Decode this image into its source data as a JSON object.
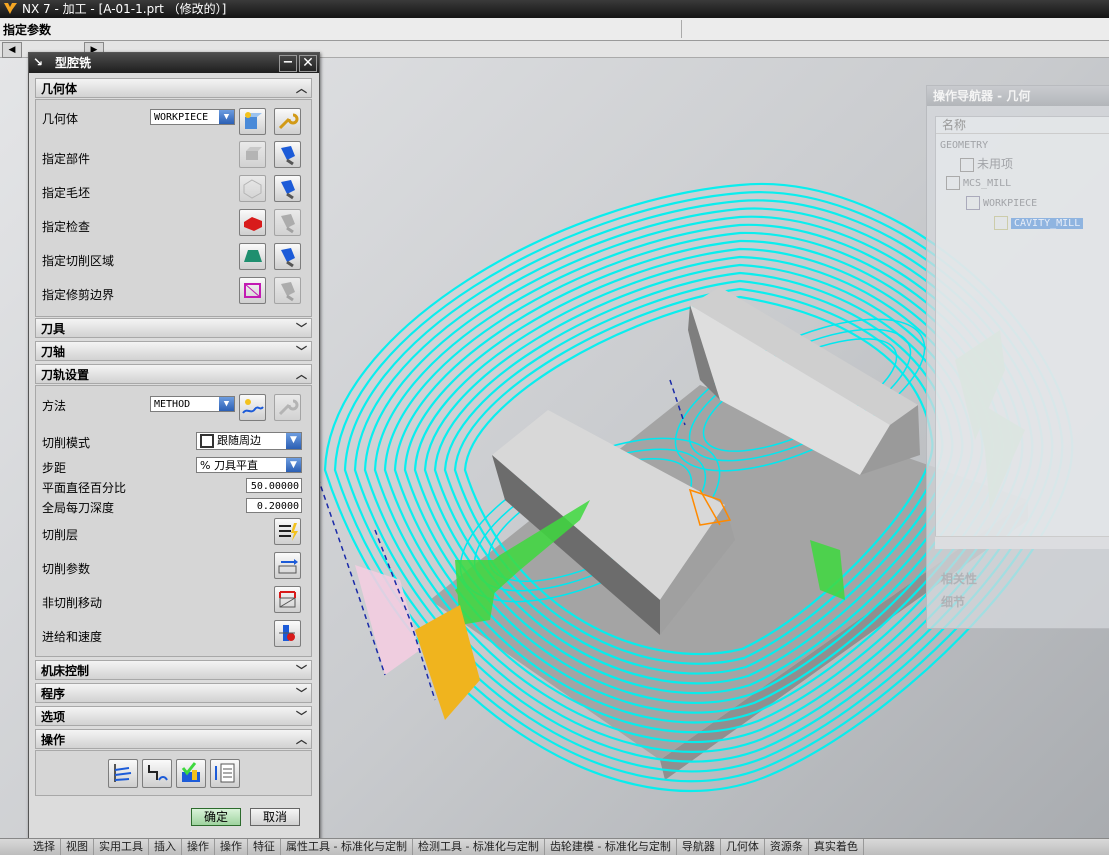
{
  "window": {
    "title": "NX 7 - 加工 - [A-01-1.prt （修改的）]"
  },
  "cue": {
    "label": "指定参数"
  },
  "dialog": {
    "title": "型腔铣",
    "sections": {
      "geometry": "几何体",
      "tool": "刀具",
      "axis": "刀轴",
      "path": "刀轨设置",
      "machine": "机床控制",
      "program": "程序",
      "options": "选项",
      "actions": "操作"
    },
    "geometry": {
      "geometry_label": "几何体",
      "geometry_value": "WORKPIECE",
      "part_label": "指定部件",
      "blank_label": "指定毛坯",
      "check_label": "指定检查",
      "cut_area_label": "指定切削区域",
      "trim_label": "指定修剪边界"
    },
    "path": {
      "method_label": "方法",
      "method_value": "METHOD",
      "cut_pattern_label": "切削模式",
      "cut_pattern_value": "跟随周边",
      "stepover_label": "步距",
      "stepover_value": "% 刀具平直",
      "percent_label": "平面直径百分比",
      "percent_value": "50.00000",
      "depth_label": "全局每刀深度",
      "depth_value": "0.20000",
      "levels_label": "切削层",
      "params_label": "切削参数",
      "noncut_label": "非切削移动",
      "feeds_label": "进给和速度"
    },
    "ok_label": "确定",
    "cancel_label": "取消"
  },
  "navigator": {
    "title": "操作导航器 - 几何",
    "column": "名称",
    "rows": [
      "GEOMETRY",
      "未用项",
      "MCS_MILL",
      "WORKPIECE",
      "CAVITY_MILL"
    ],
    "footer1": "相关性",
    "footer2": "细节"
  },
  "taskbar": {
    "items": [
      "选择",
      "视图",
      "实用工具",
      "插入",
      "操作",
      "操作",
      "特征",
      "属性工具 - 标准化与定制",
      "检测工具 - 标准化与定制",
      "齿轮建模 - 标准化与定制",
      "导航器",
      "几何体",
      "资源条",
      "真实着色"
    ]
  },
  "colors": {
    "toolpath": "#00f0f0",
    "titlebar": "#1e1e1e",
    "ok": "#9fd39f"
  }
}
